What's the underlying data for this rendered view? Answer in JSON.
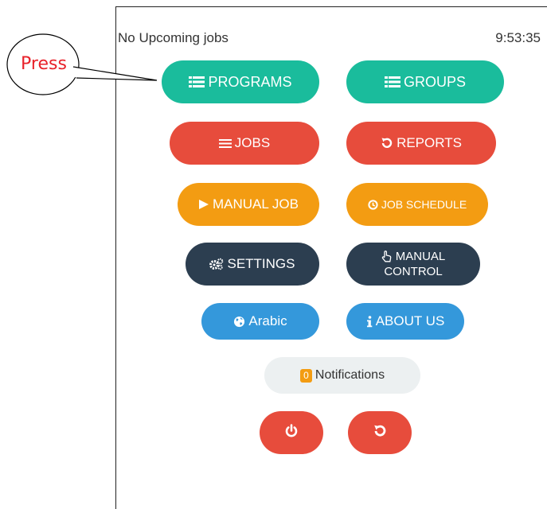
{
  "status": {
    "left": "No Upcoming jobs",
    "time": "9:53:35"
  },
  "annotation": {
    "label": "Press",
    "text_color": "#e8222a"
  },
  "buttons": {
    "programs": {
      "label": "PROGRAMS",
      "icon": "list-icon",
      "color": "#1abc9c"
    },
    "groups": {
      "label": "GROUPS",
      "icon": "list-icon",
      "color": "#1abc9c"
    },
    "jobs": {
      "label": "JOBS",
      "icon": "list-icon",
      "color": "#e74c3c"
    },
    "reports": {
      "label": "REPORTS",
      "icon": "history-icon",
      "color": "#e74c3c"
    },
    "manual_job": {
      "label": "MANUAL JOB",
      "icon": "play-icon",
      "color": "#f39c12"
    },
    "job_schedule": {
      "label": "JOB SCHEDULE",
      "icon": "clock-icon",
      "color": "#f39c12"
    },
    "settings": {
      "label": "SETTINGS",
      "icon": "gears-icon",
      "color": "#2c3e50"
    },
    "manual_control": {
      "label_line1": "MANUAL",
      "label_line2": "CONTROL",
      "icon": "hand-pointer-icon",
      "color": "#2c3e50"
    },
    "arabic": {
      "label": "Arabic",
      "icon": "globe-icon",
      "color": "#3498db"
    },
    "about_us": {
      "label": "ABOUT US",
      "icon": "info-icon",
      "color": "#3498db"
    },
    "notifications": {
      "label": "Notifications",
      "badge": "0",
      "badge_color": "#f39c12"
    },
    "power": {
      "icon": "power-icon",
      "color": "#e74c3c"
    },
    "restart": {
      "icon": "restart-icon",
      "color": "#e74c3c"
    }
  }
}
